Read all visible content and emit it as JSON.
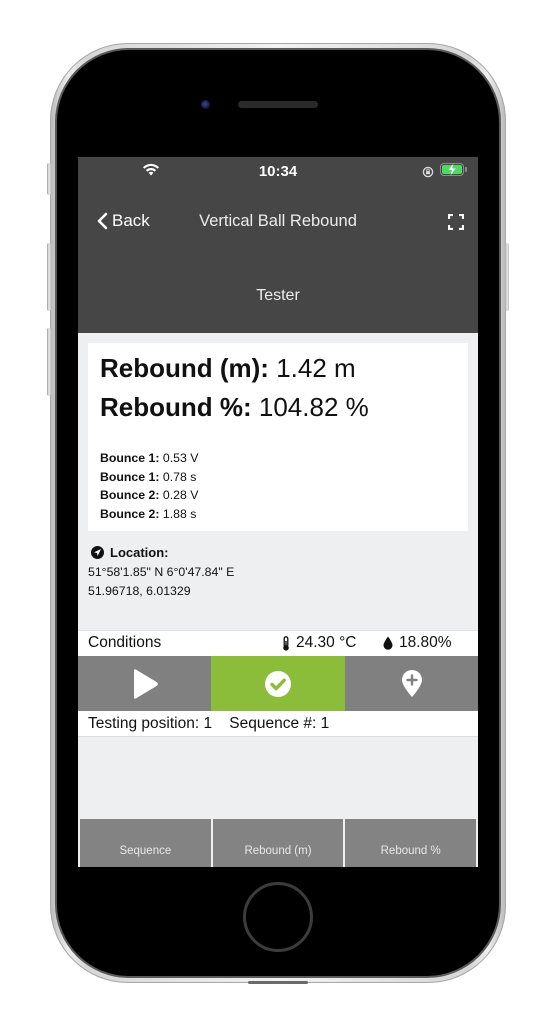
{
  "status_bar": {
    "time": "10:34",
    "icons": [
      "wifi-icon",
      "rotation-lock-icon",
      "battery-charging-icon"
    ],
    "battery_color": "#4cd964"
  },
  "nav": {
    "back_label": "Back",
    "title": "Vertical Ball Rebound",
    "expand_icon": "fullscreen-icon",
    "subtitle": "Tester"
  },
  "results": {
    "rebound_m_label": "Rebound (m):",
    "rebound_m_value": "1.42 m",
    "rebound_pct_label": "Rebound %:",
    "rebound_pct_value": "104.82 %",
    "bounces": [
      {
        "label": "Bounce 1:",
        "value": "0.53 V"
      },
      {
        "label": "Bounce 1:",
        "value": "0.78 s"
      },
      {
        "label": "Bounce 2:",
        "value": "0.28 V"
      },
      {
        "label": "Bounce 2:",
        "value": "1.88 s"
      }
    ]
  },
  "location": {
    "label": "Location:",
    "dms": "51°58'1.85\" N 6°0'47.84\" E",
    "decimal": "51.96718, 6.01329"
  },
  "conditions": {
    "label": "Conditions",
    "temperature": "24.30 °C",
    "humidity": "18.80%"
  },
  "actions": {
    "items": [
      {
        "name": "play",
        "icon": "play-icon"
      },
      {
        "name": "confirm",
        "icon": "check-circle-icon",
        "active": true
      },
      {
        "name": "add-location",
        "icon": "map-pin-plus-icon"
      }
    ],
    "active_color": "#8cbd3a",
    "inactive_color": "#808080"
  },
  "position": {
    "text": "Testing position: 1    Sequence #: 1"
  },
  "tabs": [
    {
      "label": "Sequence"
    },
    {
      "label": "Rebound (m)"
    },
    {
      "label": "Rebound %"
    }
  ]
}
